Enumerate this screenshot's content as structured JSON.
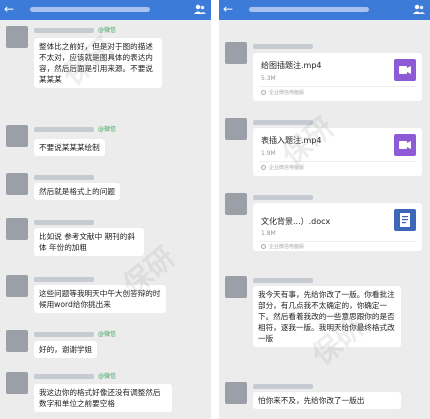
{
  "watermark": "保研",
  "icons": {
    "back": "back-arrow-icon",
    "contacts": "people-icon",
    "video": "video-file-icon",
    "doc": "doc-file-icon",
    "source": "source-icon"
  },
  "colors": {
    "header": "#3c7bd8",
    "wechat_tag": "#3aa55a",
    "video_icon": "#8e5bd6",
    "doc_icon": "#3d66b8"
  },
  "left": {
    "tag": "@微信",
    "messages": [
      "整体比之前好，但是对于图的描述不太对，应该就是图具体的表达内容，然后后面是引用来源。不要说某某某",
      "不要说某某某绘制",
      "然后就是格式上的问题",
      "比如说 参考文献中 期刊的斜体 年份的加粗",
      "这些问题等我明天中午大创答辩的时候用word给你挑出来",
      "好的，谢谢学姐",
      "我这边你的格式好像还没有调整然后数字和单位之前要空格"
    ]
  },
  "right": {
    "files": [
      {
        "name": "给图插题注.mp4",
        "size": "5.3M",
        "source": "企业微信电脑版"
      },
      {
        "name": "表插入题注.mp4",
        "size": "1.9M",
        "source": "企业微信电脑版"
      },
      {
        "name": "文化背景...）.docx",
        "size": "1.8M",
        "source": "企业微信电脑版"
      }
    ],
    "messages": [
      "我今天有事，先给你改了一版。你看批注部分，有几点我不太确定的，你确定一下。然后看着我改的一些意思跟你的是否相符，逐我一版。我明天给你最终格式改一版",
      "怕你来不及，先给你改了一版出"
    ]
  }
}
